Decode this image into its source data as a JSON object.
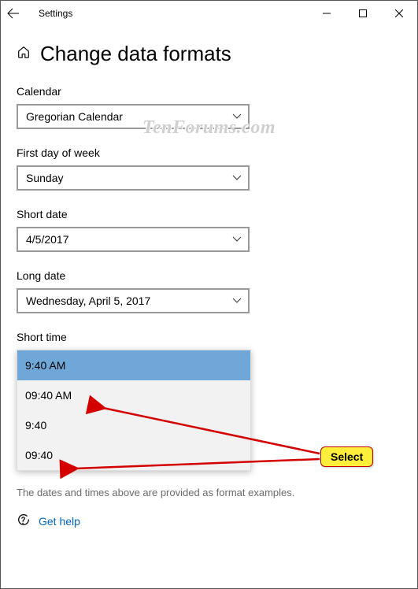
{
  "window": {
    "app_title": "Settings"
  },
  "page": {
    "title": "Change data formats",
    "hint": "The dates and times above are provided as format examples.",
    "help_link": "Get help"
  },
  "fields": {
    "calendar": {
      "label": "Calendar",
      "value": "Gregorian Calendar"
    },
    "first_day": {
      "label": "First day of week",
      "value": "Sunday"
    },
    "short_date": {
      "label": "Short date",
      "value": "4/5/2017"
    },
    "long_date": {
      "label": "Long date",
      "value": "Wednesday, April 5, 2017"
    },
    "short_time": {
      "label": "Short time"
    }
  },
  "short_time_options": [
    {
      "label": "9:40 AM",
      "selected": true
    },
    {
      "label": "09:40 AM",
      "selected": false
    },
    {
      "label": "9:40",
      "selected": false
    },
    {
      "label": "09:40",
      "selected": false
    }
  ],
  "annotation": {
    "callout": "Select"
  },
  "watermark": "TenForums.com"
}
